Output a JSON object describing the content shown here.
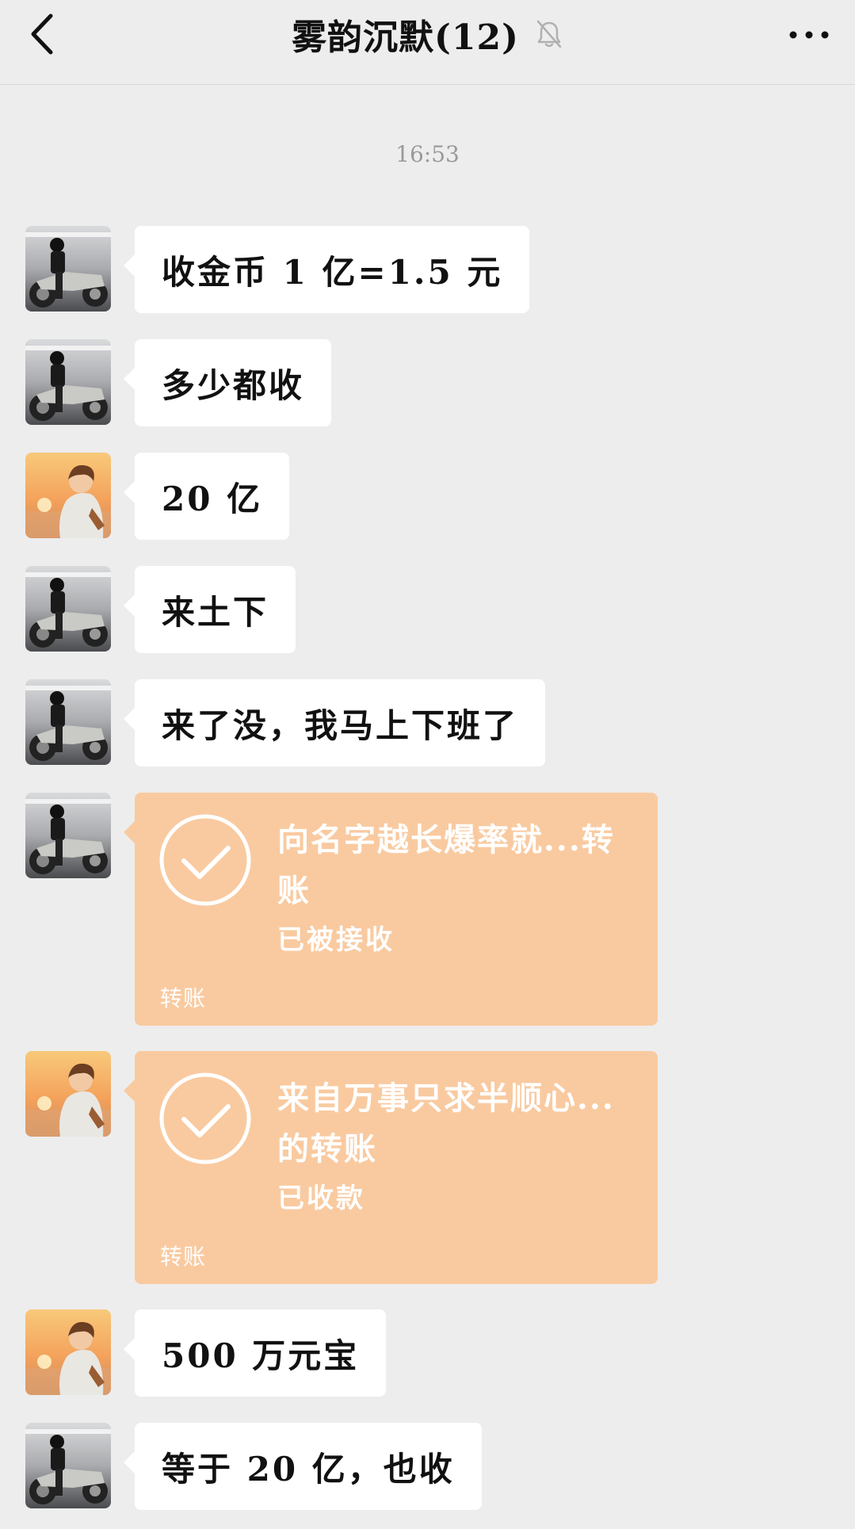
{
  "header": {
    "title": "雾韵沉默(12)",
    "back_icon": "chevron-left-icon",
    "mute_icon": "bell-off-icon",
    "more_icon": "more-horizontal-icon"
  },
  "chat": {
    "timestamp": "16:53",
    "messages": [
      {
        "type": "text",
        "avatar": "motorcycle-man-avatar",
        "text": "收金币 1 亿=1.5 元"
      },
      {
        "type": "text",
        "avatar": "motorcycle-man-avatar",
        "text": "多少都收"
      },
      {
        "type": "text",
        "avatar": "sunset-boy-avatar",
        "text": "20 亿"
      },
      {
        "type": "text",
        "avatar": "motorcycle-man-avatar",
        "text": "来土下"
      },
      {
        "type": "text",
        "avatar": "motorcycle-man-avatar",
        "text": "来了没，我马上下班了"
      },
      {
        "type": "transfer",
        "avatar": "motorcycle-man-avatar",
        "title": "向名字越长爆率就...转账",
        "status": "已被接收",
        "footer": "转账"
      },
      {
        "type": "transfer",
        "avatar": "sunset-boy-avatar",
        "title": "来自万事只求半顺心...的转账",
        "status": "已收款",
        "footer": "转账"
      },
      {
        "type": "text",
        "avatar": "sunset-boy-avatar",
        "text": "500 万元宝"
      },
      {
        "type": "text",
        "avatar": "motorcycle-man-avatar",
        "text": "等于 20 亿，也收"
      }
    ]
  },
  "colors": {
    "background": "#ededed",
    "bubble": "#ffffff",
    "transfer": "#f9caa0",
    "timestamp": "#9a9a9a"
  }
}
